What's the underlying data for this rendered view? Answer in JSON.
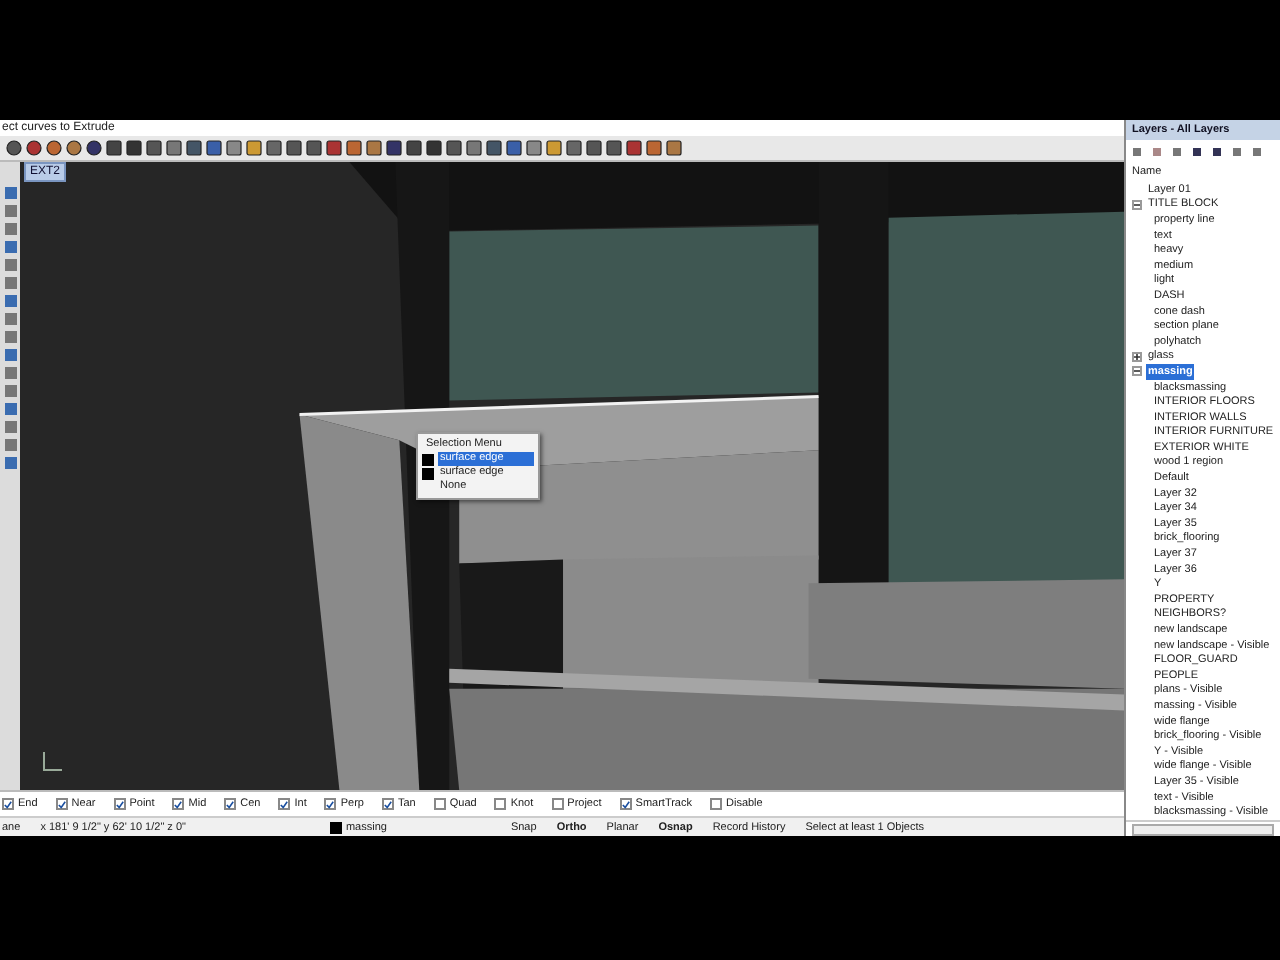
{
  "command_prompt": "ect curves to Extrude",
  "viewport": {
    "tab": "EXT2"
  },
  "selection_menu": {
    "title": "Selection Menu",
    "items": [
      {
        "label": "surface edge",
        "kind": "swatch",
        "selected": true
      },
      {
        "label": "surface edge",
        "kind": "swatch",
        "selected": false
      },
      {
        "label": "None",
        "kind": "plain",
        "selected": false
      }
    ]
  },
  "layers": {
    "title": "Layers - All Layers",
    "column": "Name",
    "items": [
      {
        "label": "Layer 01",
        "selected": false
      },
      {
        "label": "TITLE BLOCK",
        "selected": false,
        "expanded": true,
        "children": [
          {
            "label": "property line",
            "selected": false
          },
          {
            "label": "text",
            "selected": false
          },
          {
            "label": "heavy",
            "selected": false
          },
          {
            "label": "medium",
            "selected": false
          },
          {
            "label": "light",
            "selected": false
          },
          {
            "label": "DASH",
            "selected": false
          },
          {
            "label": "cone dash",
            "selected": false
          },
          {
            "label": "section plane",
            "selected": false
          },
          {
            "label": "polyhatch",
            "selected": false
          }
        ]
      },
      {
        "label": "glass",
        "selected": false,
        "expanded": false
      },
      {
        "label": "massing",
        "selected": true,
        "expanded": true,
        "children": [
          {
            "label": "blacksmassing",
            "selected": false
          },
          {
            "label": "INTERIOR FLOORS",
            "selected": false
          },
          {
            "label": "INTERIOR WALLS",
            "selected": false
          },
          {
            "label": "INTERIOR FURNITURE",
            "selected": false
          },
          {
            "label": "EXTERIOR WHITE",
            "selected": false
          },
          {
            "label": "wood 1 region",
            "selected": false
          },
          {
            "label": "Default",
            "selected": false
          },
          {
            "label": "Layer 32",
            "selected": false
          },
          {
            "label": "Layer 34",
            "selected": false
          },
          {
            "label": "Layer 35",
            "selected": false
          },
          {
            "label": "brick_flooring",
            "selected": false
          },
          {
            "label": "Layer 37",
            "selected": false
          },
          {
            "label": "Layer 36",
            "selected": false
          },
          {
            "label": "Y",
            "selected": false
          },
          {
            "label": "PROPERTY",
            "selected": false
          },
          {
            "label": "NEIGHBORS?",
            "selected": false
          },
          {
            "label": "new landscape",
            "selected": false
          },
          {
            "label": "new landscape - Visible",
            "selected": false
          },
          {
            "label": "FLOOR_GUARD",
            "selected": false
          },
          {
            "label": "PEOPLE",
            "selected": false
          },
          {
            "label": "plans - Visible",
            "selected": false
          },
          {
            "label": "massing - Visible",
            "selected": false
          },
          {
            "label": "wide flange",
            "selected": false
          },
          {
            "label": "brick_flooring - Visible",
            "selected": false
          },
          {
            "label": "Y - Visible",
            "selected": false
          },
          {
            "label": "wide flange - Visible",
            "selected": false
          },
          {
            "label": "Layer 35 - Visible",
            "selected": false
          },
          {
            "label": "text - Visible",
            "selected": false
          },
          {
            "label": "blacksmassing - Visible",
            "selected": false
          }
        ]
      }
    ]
  },
  "osnap": [
    {
      "label": "End",
      "checked": true
    },
    {
      "label": "Near",
      "checked": true
    },
    {
      "label": "Point",
      "checked": true
    },
    {
      "label": "Mid",
      "checked": true
    },
    {
      "label": "Cen",
      "checked": true
    },
    {
      "label": "Int",
      "checked": true
    },
    {
      "label": "Perp",
      "checked": true
    },
    {
      "label": "Tan",
      "checked": true
    },
    {
      "label": "Quad",
      "checked": false
    },
    {
      "label": "Knot",
      "checked": false
    },
    {
      "label": "Project",
      "checked": false
    },
    {
      "label": "SmartTrack",
      "checked": true
    },
    {
      "label": "Disable",
      "checked": false
    }
  ],
  "status_bar": {
    "plane": "ane",
    "coordinates": "x 181' 9 1/2\" y 62' 10 1/2\" z 0\"",
    "layer": "massing",
    "toggles": [
      {
        "label": "Snap",
        "on": false
      },
      {
        "label": "Ortho",
        "on": true
      },
      {
        "label": "Planar",
        "on": false
      },
      {
        "label": "Osnap",
        "on": true
      },
      {
        "label": "Record History",
        "on": false
      }
    ],
    "message": "Select at least 1 Objects"
  }
}
